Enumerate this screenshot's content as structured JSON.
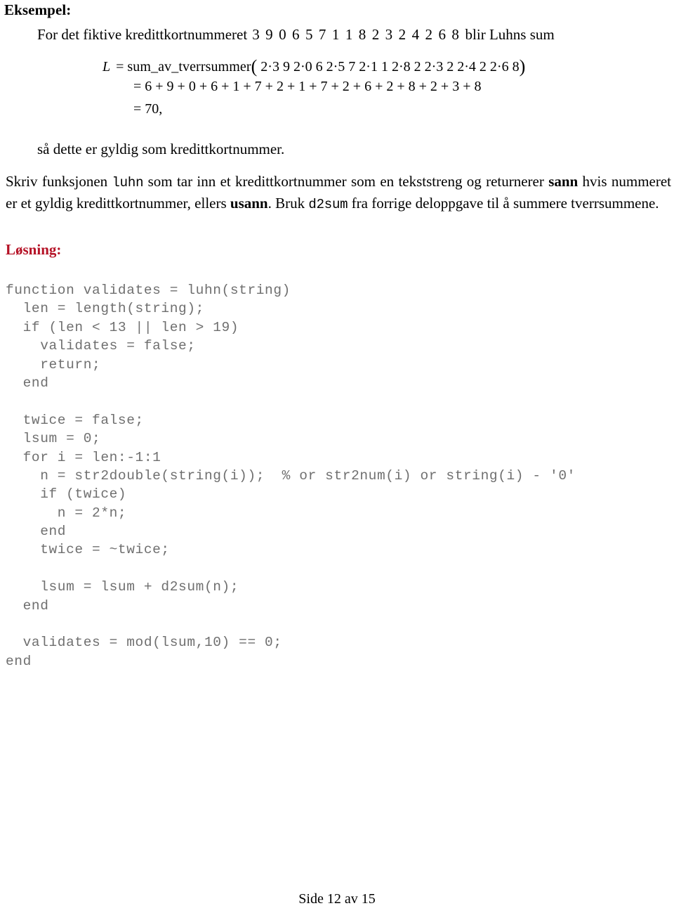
{
  "document": {
    "heading_example": "Eksempel:",
    "heading_solution": "Løsning:",
    "footer": "Side 12 av 15"
  },
  "example": {
    "intro_before": "For det fiktive kredittkortnummeret",
    "card_number": "3 9 0 6 5 7 1 1 8 2 3 2 4 2 6 8",
    "intro_after": "blir Luhns sum",
    "closing": "så dette er gyldig som kredittkortnummer."
  },
  "math": {
    "lhs": "L",
    "eq": "=",
    "function_name": "sum_av_tverrsummer",
    "open_paren": "(",
    "close_paren": ")",
    "args": "2·3 9 2·0 6 2·5 7 2·1 1 2·8 2 2·3 2 2·4 2 2·6 8",
    "line2": "= 6 + 9 + 0 + 6 + 1 + 7 + 2 + 1 + 7 + 2 + 6 + 2 + 8 + 2 + 3 + 8",
    "line3": "= 70,"
  },
  "paragraph": {
    "part1": "Skriv funksjonen ",
    "code1": "luhn",
    "part2": " som tar inn et kredittkortnummer som en tekststreng og returnerer ",
    "bold1": "sann",
    "part3": " hvis nummeret er et gyldig kredittkortnummer, ellers ",
    "bold2": "usann",
    "part4": ". Bruk ",
    "code2": "d2sum",
    "part5": " fra forrige deloppgave til å summere tverrsummene."
  },
  "code": {
    "color": "#6f6f6f",
    "lines": [
      "function validates = luhn(string)",
      "  len = length(string);",
      "  if (len < 13 || len > 19)",
      "    validates = false;",
      "    return;",
      "  end",
      "",
      "  twice = false;",
      "  lsum = 0;",
      "  for i = len:-1:1",
      "    n = str2double(string(i));  % or str2num(i) or string(i) - '0'",
      "    if (twice)",
      "      n = 2*n;",
      "    end",
      "    twice = ~twice;",
      "",
      "    lsum = lsum + d2sum(n);",
      "  end",
      "",
      "  validates = mod(lsum,10) == 0;",
      "end"
    ]
  },
  "colors": {
    "solution_heading": "#b51226",
    "code_text": "#6f6f6f",
    "body_text": "#000000"
  }
}
